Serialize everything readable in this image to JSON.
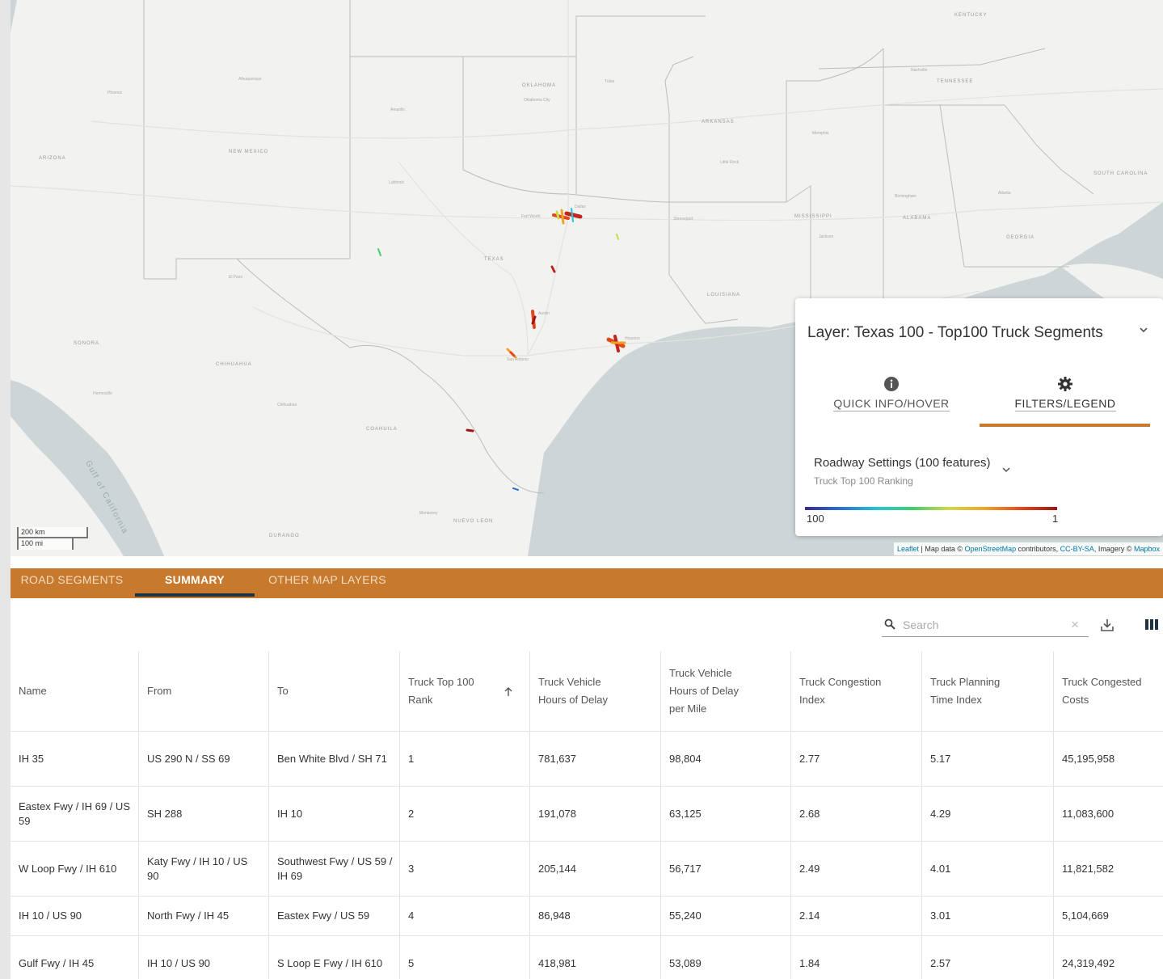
{
  "map": {
    "state_labels": [
      "ARIZONA",
      "NEW MEXICO",
      "OKLAHOMA",
      "ARKANSAS",
      "TEXAS",
      "LOUISIANA",
      "MISSISSIPPI",
      "ALABAMA",
      "GEORGIA",
      "TENNESSEE",
      "KENTUCKY",
      "SOUTH CAROLINA",
      "SONORA",
      "CHIHUAHUA",
      "COAHUILA",
      "DURANGO",
      "NUEVO LEON"
    ],
    "city_labels": [
      "Phoenix",
      "Albuquerque",
      "Amarillo",
      "Lubbock",
      "Oklahoma City",
      "Fort Worth",
      "Dallas",
      "Austin",
      "San Antonio",
      "Houston",
      "El Paso",
      "Shreveport",
      "Jackson",
      "Birmingham",
      "Atlanta",
      "Memphis",
      "Nashville",
      "Little Rock",
      "Tulsa",
      "Monterrey",
      "Chihuahua",
      "Hermosillo"
    ],
    "gulf_label": "Gulf of California",
    "scale": {
      "km": "200 km",
      "mi": "100 mi"
    },
    "attribution": {
      "leaflet": "Leaflet",
      "sep1": " | Map data © ",
      "osm": "OpenStreetMap",
      "mid": " contributors, ",
      "cc": "CC-BY-SA",
      "mid2": ", Imagery © ",
      "mapbox": "Mapbox"
    }
  },
  "panel": {
    "title": "Layer: Texas 100 - Top100 Truck Segments",
    "tab_info": "QUICK INFO/HOVER",
    "tab_filters": "FILTERS/LEGEND",
    "roadway_settings": "Roadway Settings (100 features)",
    "roadway_sub": "Truck Top 100 Ranking",
    "legend_low": "100",
    "legend_high": "1",
    "legend_colors": [
      "#3a2a8c",
      "#2b6fd6",
      "#22c6d6",
      "#3fcf6b",
      "#cfd94a",
      "#f2a326",
      "#e2481e",
      "#9c1414"
    ],
    "accent": "#c87a2e"
  },
  "tabs": [
    {
      "label": "ROAD SEGMENTS"
    },
    {
      "label": "SUMMARY"
    },
    {
      "label": "OTHER MAP LAYERS"
    }
  ],
  "toolbar": {
    "search_placeholder": "Search",
    "clear": "×"
  },
  "table": {
    "headers": [
      "Name",
      "From",
      "To",
      "Truck Top 100 Rank",
      "Truck Vehicle Hours of Delay",
      "Truck Vehicle Hours of Delay per Mile",
      "Truck Congestion Index",
      "Truck Planning Time Index",
      "Truck Congested Costs"
    ],
    "rows": [
      [
        "IH 35",
        "US 290 N / SS 69",
        "Ben White Blvd / SH 71",
        "1",
        "781,637",
        "98,804",
        "2.77",
        "5.17",
        "45,195,958"
      ],
      [
        "Eastex Fwy / IH 69 / US 59",
        "SH 288",
        "IH 10",
        "2",
        "191,078",
        "63,125",
        "2.68",
        "4.29",
        "11,083,600"
      ],
      [
        "W Loop Fwy / IH 610",
        "Katy Fwy / IH 10 / US 90",
        "Southwest Fwy / US 59 / IH 69",
        "3",
        "205,144",
        "56,717",
        "2.49",
        "4.01",
        "11,821,582"
      ],
      [
        "IH 10 / US 90",
        "North Fwy / IH 45",
        "Eastex Fwy / US 59",
        "4",
        "86,948",
        "55,240",
        "2.14",
        "3.01",
        "5,104,669"
      ],
      [
        "Gulf Fwy / IH 45",
        "IH 10 / US 90",
        "S Loop E Fwy / IH 610",
        "5",
        "418,981",
        "53,089",
        "1.84",
        "2.57",
        "24,319,492"
      ]
    ]
  },
  "colors": {
    "tabbar": "#c77a2d",
    "tab_indicator": "#1f3347",
    "water": "#c9d2d3"
  }
}
